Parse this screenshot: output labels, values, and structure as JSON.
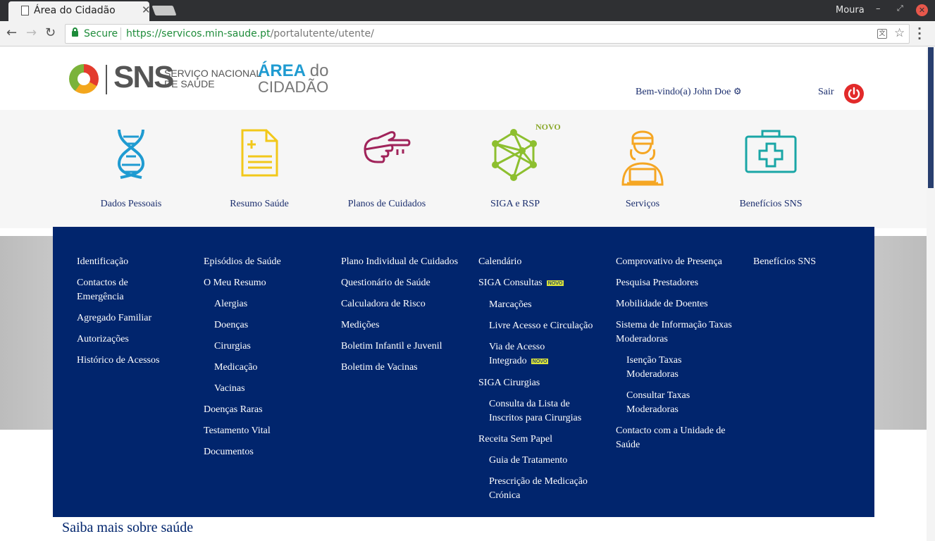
{
  "browser": {
    "tab_title": "Área do Cidadão",
    "window_user": "Moura",
    "secure_label": "Secure",
    "url_host": "https://servicos.min-saude.pt",
    "url_path": "/portalutente/utente/"
  },
  "header": {
    "logo_sns": "SNS",
    "logo_sub_1": "SERVIÇO NACIONAL",
    "logo_sub_2": "DE SAÚDE",
    "area_1": "ÁREA",
    "area_do": "do",
    "area_2": "CIDADÃO",
    "welcome": "Bem-vindo(a) John Doe",
    "logout": "Sair"
  },
  "icons": [
    {
      "label": "Dados Pessoais",
      "icon": "dna-icon",
      "color": "#1f9bd1"
    },
    {
      "label": "Resumo Saúde",
      "icon": "document-icon",
      "color": "#f2c81a"
    },
    {
      "label": "Planos de Cuidados",
      "icon": "pointing-hand-icon",
      "color": "#a0235a"
    },
    {
      "label": "SIGA e RSP",
      "icon": "network-icon",
      "color": "#8dbf2f"
    },
    {
      "label": "Serviços",
      "icon": "nurse-icon",
      "color": "#f5a623"
    },
    {
      "label": "Benefícios SNS",
      "icon": "medkit-icon",
      "color": "#1aa6a6"
    }
  ],
  "novo_badge": "NOVO",
  "menu": {
    "col1": [
      "Identificação",
      "Contactos de",
      "Emergência",
      "Agregado Familiar",
      "Autorizações",
      "Histórico de Acessos"
    ],
    "col2": [
      "Episódios de Saúde",
      "O Meu Resumo",
      "Alergias",
      "Doenças",
      "Cirurgias",
      "Medicação",
      "Vacinas",
      "Doenças Raras",
      "Testamento Vital",
      "Documentos"
    ],
    "col3": [
      "Plano Individual de Cuidados",
      "Questionário de Saúde",
      "Calculadora de Risco",
      "Medições",
      "Boletim Infantil e Juvenil",
      "Boletim de Vacinas"
    ],
    "col4": [
      "Calendário",
      "SIGA Consultas",
      "Marcações",
      "Livre Acesso e Circulação",
      "Via de Acesso",
      "Integrado",
      "SIGA Cirurgias",
      "Consulta da Lista de",
      "Inscritos para Cirurgias",
      "Receita Sem Papel",
      "Guia de Tratamento",
      "Prescrição de Medicação",
      "Crónica"
    ],
    "col5": [
      "Comprovativo de Presença",
      "Pesquisa Prestadores",
      "Mobilidade de Doentes",
      "Sistema de Informação Taxas",
      "Moderadoras",
      "Isenção Taxas",
      "Moderadoras",
      "Consultar Taxas",
      "Moderadoras",
      "Contacto com a Unidade de",
      "Saúde"
    ],
    "col6": [
      "Benefícios SNS"
    ],
    "novo_tag": "NOVO"
  },
  "footer_heading": "Saiba mais sobre saúde"
}
